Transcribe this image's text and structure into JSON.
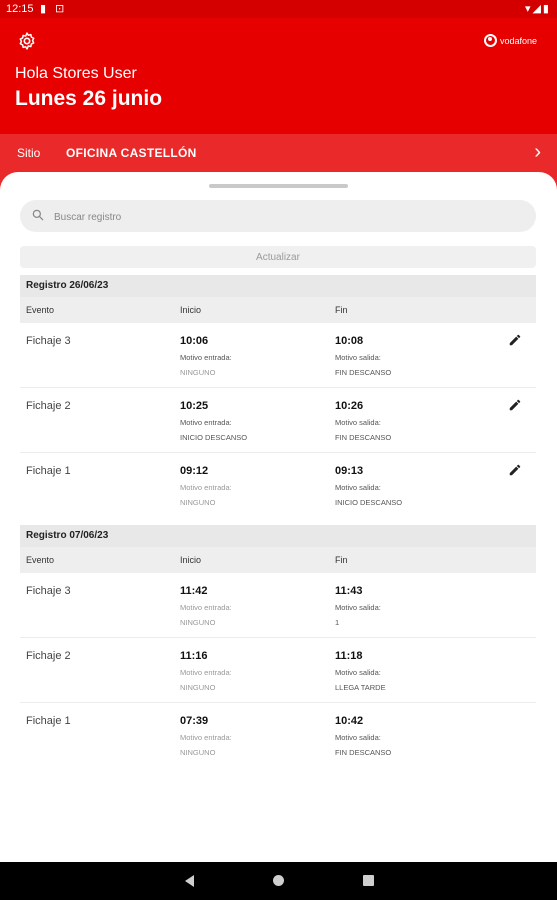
{
  "status_bar": {
    "time": "12:15"
  },
  "header": {
    "brand": "vodafone",
    "greeting": "Hola Stores User",
    "date": "Lunes 26 junio"
  },
  "site": {
    "label": "Sitio",
    "value": "OFICINA CASTELLÓN"
  },
  "search": {
    "placeholder": "Buscar registro"
  },
  "update_label": "Actualizar",
  "columns": {
    "event": "Evento",
    "start": "Inicio",
    "end": "Fin"
  },
  "groups": [
    {
      "title": "Registro 26/06/23",
      "rows": [
        {
          "event": "Fichaje 3",
          "start": "10:06",
          "start_label": "Motivo entrada:",
          "start_reason": "NINGUNO",
          "end": "10:08",
          "end_label": "Motivo salida:",
          "end_reason": "FIN DESCANSO"
        },
        {
          "event": "Fichaje 2",
          "start": "10:25",
          "start_label": "Motivo entrada:",
          "start_reason": "INICIO DESCANSO",
          "end": "10:26",
          "end_label": "Motivo salida:",
          "end_reason": "FIN DESCANSO"
        },
        {
          "event": "Fichaje 1",
          "start": "09:12",
          "start_label": "Motivo entrada:",
          "start_reason": "NINGUNO",
          "end": "09:13",
          "end_label": "Motivo salida:",
          "end_reason": "INICIO DESCANSO"
        }
      ]
    },
    {
      "title": "Registro 07/06/23",
      "rows": [
        {
          "event": "Fichaje 3",
          "start": "11:42",
          "start_label": "Motivo entrada:",
          "start_reason": "NINGUNO",
          "end": "11:43",
          "end_label": "Motivo salida:",
          "end_reason": "1"
        },
        {
          "event": "Fichaje 2",
          "start": "11:16",
          "start_label": "Motivo entrada:",
          "start_reason": "NINGUNO",
          "end": "11:18",
          "end_label": "Motivo salida:",
          "end_reason": "LLEGA TARDE"
        },
        {
          "event": "Fichaje 1",
          "start": "07:39",
          "start_label": "Motivo entrada:",
          "start_reason": "NINGUNO",
          "end": "10:42",
          "end_label": "Motivo salida:",
          "end_reason": "FIN DESCANSO"
        }
      ]
    }
  ]
}
